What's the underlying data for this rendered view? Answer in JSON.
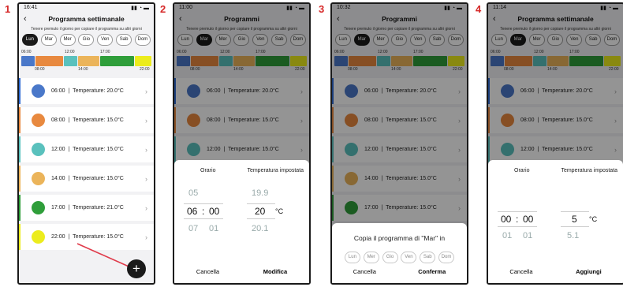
{
  "steps": [
    "1",
    "2",
    "3",
    "4"
  ],
  "screens": [
    {
      "time": "16:41",
      "title": "Programma settimanale",
      "hint": "Tenere premuto il giorno per copiare il programma su altri giorni",
      "selected_day": 0,
      "rows": [
        {
          "time": "06:00",
          "temp": "20.0°C",
          "color": "#4a78c9"
        },
        {
          "time": "08:00",
          "temp": "15.0°C",
          "color": "#e8893f"
        },
        {
          "time": "12:00",
          "temp": "15.0°C",
          "color": "#5ac1bd"
        },
        {
          "time": "14:00",
          "temp": "15.0°C",
          "color": "#ebb45a"
        },
        {
          "time": "17:00",
          "temp": "21.0°C",
          "color": "#2f9e3a"
        },
        {
          "time": "22:00",
          "temp": "15.0°C",
          "color": "#ecec1d"
        }
      ],
      "fab": "+"
    },
    {
      "time": "11:00",
      "title": "Programmi",
      "hint": "Tenere premuto il giorno per copiare il programma su altri giorni",
      "selected_day": 1,
      "rows": [
        {
          "time": "06:00",
          "temp": "20.0°C",
          "color": "#4a78c9"
        },
        {
          "time": "08:00",
          "temp": "15.0°C",
          "color": "#e8893f"
        },
        {
          "time": "12:00",
          "temp": "15.0°C",
          "color": "#5ac1bd"
        }
      ],
      "sheet": {
        "col1": "Orario",
        "col2": "Temperatura impostata",
        "hours_prev": "05",
        "hours_sel": "06",
        "hours_next": "07",
        "sep": ":",
        "mins_sel": "00",
        "mins_next": "01",
        "temp_prev": "19.9",
        "temp_sel": "20",
        "temp_next": "20.1",
        "unit": "°C",
        "cancel": "Cancella",
        "confirm": "Modifica"
      }
    },
    {
      "time": "10:32",
      "title": "Programmi",
      "hint": "Tenere premuto il giorno per copiare il programma su altri giorni",
      "selected_day": 1,
      "rows": [
        {
          "time": "06:00",
          "temp": "20.0°C",
          "color": "#4a78c9"
        },
        {
          "time": "08:00",
          "temp": "15.0°C",
          "color": "#e8893f"
        },
        {
          "time": "12:00",
          "temp": "15.0°C",
          "color": "#5ac1bd"
        },
        {
          "time": "14:00",
          "temp": "15.0°C",
          "color": "#ebb45a"
        },
        {
          "time": "17:00",
          "temp": "15.0°C",
          "color": "#2f9e3a"
        }
      ],
      "copy": {
        "title": "Copia il programma di \"Mar\" in",
        "days": [
          "Lun",
          "Mer",
          "Gio",
          "Ven",
          "Sab",
          "Dom"
        ],
        "cancel": "Cancella",
        "confirm": "Conferma"
      }
    },
    {
      "time": "11:14",
      "title": "Programma settimanale",
      "hint": "Tenere premuto il giorno per copiare il programma su altri giorni",
      "selected_day": 1,
      "rows": [
        {
          "time": "06:00",
          "temp": "20.0°C",
          "color": "#4a78c9"
        },
        {
          "time": "08:00",
          "temp": "15.0°C",
          "color": "#e8893f"
        },
        {
          "time": "12:00",
          "temp": "15.0°C",
          "color": "#5ac1bd"
        }
      ],
      "sheet": {
        "col1": "Orario",
        "col2": "Temperatura impostata",
        "hours_sel": "00",
        "hours_next": "01",
        "sep": ":",
        "mins_sel": "00",
        "mins_next": "01",
        "temp_sel": "5",
        "temp_next": "5.1",
        "unit": "°C",
        "cancel": "Cancella",
        "confirm": "Aggiungi"
      }
    }
  ],
  "days": [
    "Lun",
    "Mar",
    "Mer",
    "Gio",
    "Ven",
    "Sab",
    "Dom"
  ],
  "timeline": {
    "top_labels": [
      "06:00",
      "12:00",
      "17:00"
    ],
    "bottom_labels": [
      "08:00",
      "14:00",
      "22:00"
    ]
  },
  "row_label": "Temperature:",
  "colors": {
    "accent": "#2f6bd4",
    "selected_day": "#1a1a1a",
    "arrow": "#e03a4a"
  },
  "icons": {
    "back": "chevron-left-icon",
    "chevron": "chevron-right-icon",
    "add": "plus-icon"
  }
}
